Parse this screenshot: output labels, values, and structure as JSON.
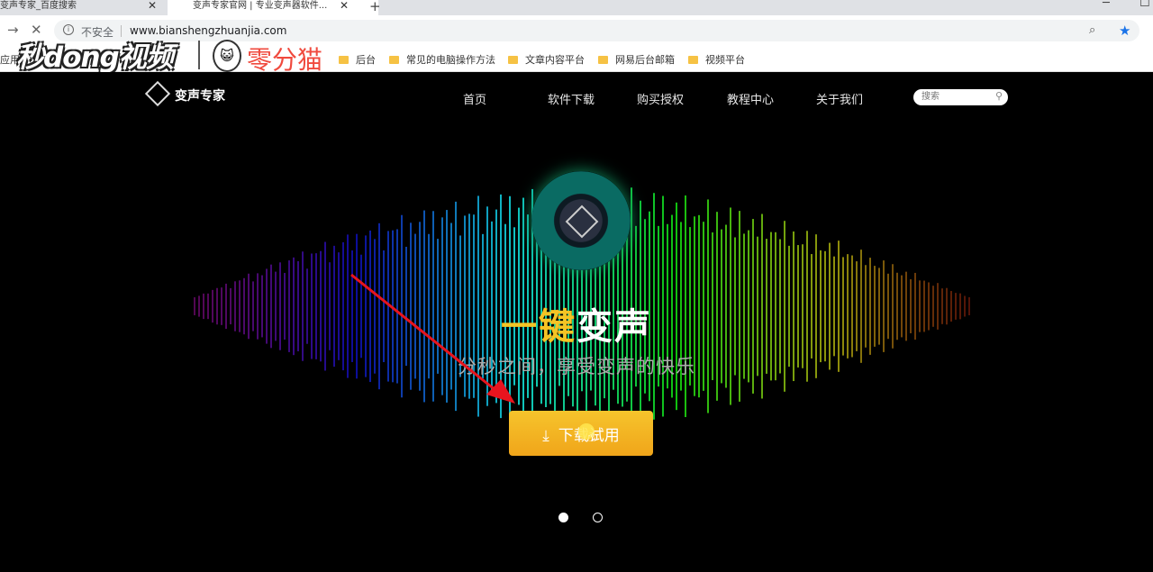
{
  "browser": {
    "tabs": [
      {
        "title": "变声专家_百度搜索"
      },
      {
        "title": "变声专家官网 | 专业变声器软件..."
      }
    ],
    "insecure_label": "不安全",
    "url": "www.bianshengzhuanjia.com",
    "bookmarks": [
      {
        "label": "应用"
      },
      {
        "label": "后台"
      },
      {
        "label": "常见的电脑操作方法"
      },
      {
        "label": "文章内容平台"
      },
      {
        "label": "网易后台邮箱"
      },
      {
        "label": "视频平台"
      }
    ]
  },
  "watermark": {
    "left": "秒dong视频",
    "right": "零分猫"
  },
  "site": {
    "logo_text": "变声专家",
    "nav": [
      "首页",
      "软件下载",
      "购买授权",
      "教程中心",
      "关于我们"
    ],
    "search_placeholder": "搜索",
    "headline_part1": "一键",
    "headline_part2": "变声",
    "subtitle": "分秒之间，享受变声的快乐",
    "cta_label": "下载试用"
  },
  "colors": {
    "accent": "#f5c424",
    "cta": "#f0a51a",
    "arrow": "#e8141e"
  }
}
